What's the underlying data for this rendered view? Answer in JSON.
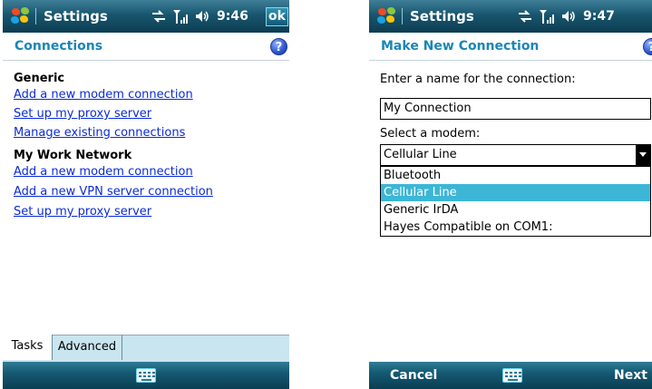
{
  "colors": {
    "titlebar": "#18566e",
    "header_title": "#1a86b6",
    "link": "#0b2bd4",
    "selection": "#3cb6d6",
    "tab_strip": "#c9e5ef"
  },
  "left": {
    "titlebar": {
      "title": "Settings",
      "time": "9:46",
      "ok_label": "ok",
      "icons": [
        "connectivity-icon",
        "signal-strength-icon",
        "volume-icon"
      ]
    },
    "header": {
      "title": "Connections",
      "help": "?"
    },
    "groups": [
      {
        "heading": "Generic",
        "links": [
          "Add a new modem connection",
          "Set up my proxy server",
          "Manage existing connections"
        ]
      },
      {
        "heading": "My Work Network",
        "links": [
          "Add a new modem connection",
          "Add a new VPN server connection",
          "Set up my proxy server"
        ]
      }
    ],
    "tabs": [
      "Tasks",
      "Advanced"
    ],
    "softbar": {
      "icon": "keyboard-icon"
    }
  },
  "right": {
    "titlebar": {
      "title": "Settings",
      "time": "9:47",
      "icons": [
        "connectivity-icon",
        "signal-strength-icon",
        "volume-icon"
      ]
    },
    "header": {
      "title": "Make New Connection",
      "help": "?"
    },
    "name_label": "Enter a name for the connection:",
    "name_value": "My Connection",
    "modem_label": "Select a modem:",
    "modem_selected": "Cellular Line",
    "modem_options": [
      "Bluetooth",
      "Cellular Line",
      "Generic IrDA",
      "Hayes Compatible on COM1:"
    ],
    "softbar": {
      "left_key": "Cancel",
      "right_key": "Next",
      "icon": "keyboard-icon"
    }
  }
}
